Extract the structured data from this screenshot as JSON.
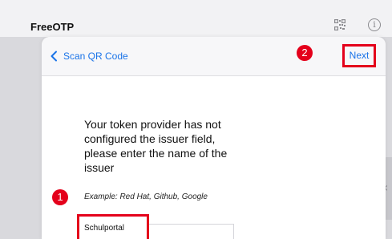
{
  "app": {
    "title": "FreeOTP",
    "info_glyph": "i"
  },
  "sheet": {
    "back_label": "Scan QR Code",
    "next_label": "Next",
    "prompt": "Your token provider has not configured the issuer field, please enter the name of the issuer",
    "example": "Example: Red Hat, Github, Google",
    "issuer_value": "Schulportal"
  },
  "annotations": {
    "badge_1": "1",
    "badge_2": "2",
    "color": "#e4001b"
  },
  "icons": {
    "qr": "qr-code-icon",
    "info": "info-icon",
    "back": "chevron-left-icon",
    "handle": "chevron-left-icon"
  },
  "colors": {
    "accent": "#1a73e8",
    "highlight": "#e4001b"
  }
}
